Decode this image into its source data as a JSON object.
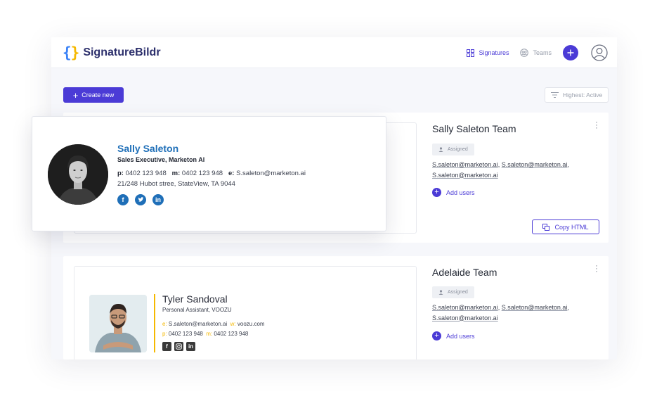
{
  "app": {
    "logo_brace_open": "{",
    "logo_brace_close": "}",
    "logo_text": "SignatureBildr",
    "accent_color": "#4b3bd6",
    "brace_colors": [
      "#3b82f6",
      "#f5b800"
    ]
  },
  "nav": {
    "signatures_label": "Signatures",
    "teams_label": "Teams",
    "add_icon": "plus-icon",
    "profile_icon": "user-avatar-icon"
  },
  "toolbar": {
    "create_label": "Create new",
    "sort_label": "Highest: Active"
  },
  "cards": [
    {
      "team_title": "Sally Saleton Team",
      "assigned_label": "Assigned",
      "emails": [
        "S.saleton@marketon.ai",
        "S.saleton@marketon.ai",
        "S.saleton@marketon.ai"
      ],
      "separator": ", ",
      "add_users_label": "Add users",
      "copy_label": "Copy HTML"
    },
    {
      "team_title": "Adelaide Team",
      "assigned_label": "Assigned",
      "emails": [
        "S.saleton@marketon.ai",
        "S.saleton@marketon.ai",
        "S.saleton@marketon.ai"
      ],
      "separator": ", ",
      "add_users_label": "Add users"
    }
  ],
  "sally": {
    "name": "Sally Saleton",
    "role": "Sales Executive, Marketon AI",
    "phone_key": "p:",
    "phone": "0402 123 948",
    "mobile_key": "m:",
    "mobile": "0402 123 948",
    "email_key": "e:",
    "email": "S.saleton@marketon.ai",
    "address": "21/248 Hubot stree, StateView, TA 9044",
    "social": [
      "f",
      "t",
      "in"
    ],
    "name_color": "#1f6fb8"
  },
  "tyler": {
    "name": "Tyler Sandoval",
    "role": "Personal Assistant, VOOZU",
    "email_key": "e:",
    "email": "S.saleton@marketon.ai",
    "web_key": "w:",
    "web": "voozu.com",
    "phone_key": "p:",
    "phone": "0402 123 948",
    "mobile_key": "m:",
    "mobile": "0402 123 948",
    "social": [
      "f",
      "ig",
      "in"
    ],
    "accent": "#f5b800"
  }
}
